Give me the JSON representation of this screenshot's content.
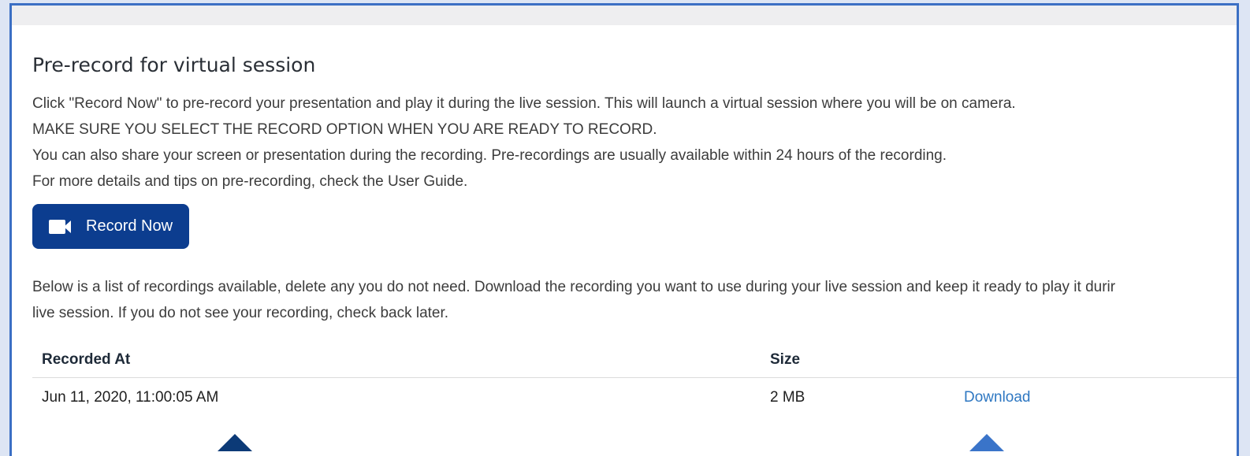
{
  "section": {
    "title": "Pre-record for virtual session",
    "description": [
      "Click \"Record Now\" to pre-record your presentation and play it during the live session. This will launch a virtual session where you will be on camera.",
      "MAKE SURE YOU SELECT THE RECORD OPTION WHEN YOU ARE READY TO RECORD.",
      "You can also share your screen or presentation during the recording. Pre-recordings are usually available within 24 hours of the recording.",
      "For more details and tips on pre-recording, check the User Guide."
    ],
    "record_button": {
      "label": "Record Now",
      "icon": "video-camera-icon"
    },
    "list_description": [
      "Below is a list of recordings available, delete any you do not need. Download the recording you want to use during your live session and keep it ready to play it durir",
      "live session. If you do not see your recording, check back later."
    ]
  },
  "table": {
    "headers": {
      "recorded_at": "Recorded At",
      "size": "Size"
    },
    "rows": [
      {
        "recorded_at": "Jun 11, 2020, 11:00:05 AM",
        "size": "2 MB",
        "action": "Download"
      }
    ]
  },
  "colors": {
    "primary_button": "#0c3d8f",
    "link": "#2f78c2",
    "frame_border": "#3b6fc4"
  }
}
